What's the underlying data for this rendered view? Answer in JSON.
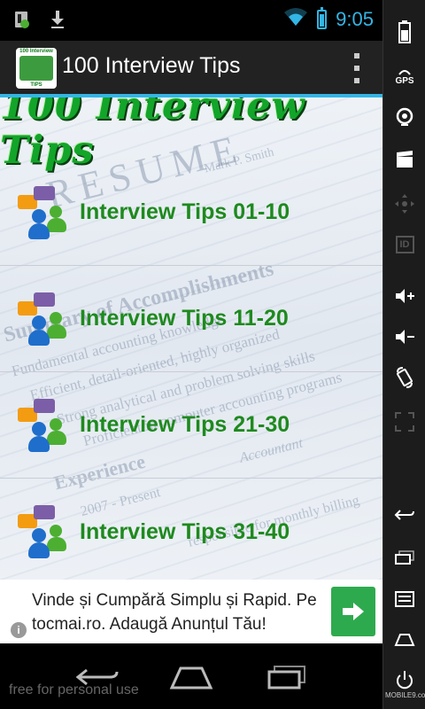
{
  "status_bar": {
    "time": "9:05",
    "icons": [
      "sim-notification-icon",
      "download-icon",
      "wifi-icon",
      "battery-charging-icon"
    ]
  },
  "action_bar": {
    "app_icon": {
      "top_text": "100 Interview",
      "bottom_text": "TIPS"
    },
    "title": "100 Interview Tips",
    "overflow_icon": "overflow-menu-icon"
  },
  "content": {
    "banner_title": "100 Interview Tips",
    "background_text": [
      "RESUME",
      "Mark P. Smith",
      "Summary of Accomplishments",
      "Fundamental accounting knowledge",
      "Efficient, detail-oriented, highly organized",
      "Strong analytical and problem solving skills",
      "Proficient in computer accounting programs",
      "Experience",
      "2007 - Present",
      "Accountant",
      "responsible for monthly billing"
    ],
    "menu_items": [
      {
        "label": "Interview Tips 01-10",
        "icon": "people-chat-icon"
      },
      {
        "label": "Interview Tips 11-20",
        "icon": "people-chat-icon"
      },
      {
        "label": "Interview Tips 21-30",
        "icon": "people-chat-icon"
      },
      {
        "label": "Interview Tips 31-40",
        "icon": "people-chat-icon"
      }
    ]
  },
  "ad": {
    "text": "Vinde și Cumpără Simplu și Rapid. Pe tocmai.ro. Adaugă Anunțul Tău!",
    "button_icon": "arrow-right-icon",
    "info_icon": "info-icon",
    "info_glyph": "i",
    "accent": "#2eaa4e"
  },
  "bottom_nav": {
    "watermark": "free for personal use",
    "buttons": [
      "back-icon",
      "home-icon",
      "recent-apps-icon"
    ]
  },
  "side_panel": {
    "gps_label": "GPS",
    "id_label": "ID",
    "brand": "MOBILE9.com"
  },
  "colors": {
    "accent_blue": "#33b5e5",
    "green_text": "#1e8a1e",
    "action_bar_bg": "#222222"
  }
}
